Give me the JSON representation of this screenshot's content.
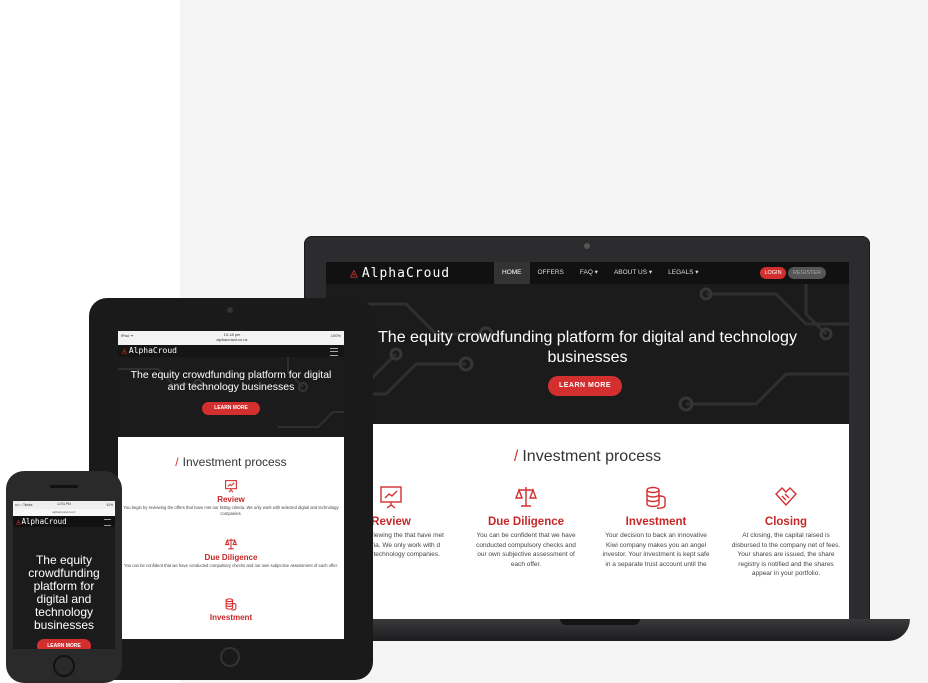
{
  "brand": {
    "name": "AlphaCroud",
    "accent": "#d32f2f"
  },
  "laptop": {
    "nav": [
      {
        "label": "HOME",
        "active": true
      },
      {
        "label": "OFFERS"
      },
      {
        "label": "FAQ ▾"
      },
      {
        "label": "ABOUT US ▾"
      },
      {
        "label": "LEGALS ▾"
      }
    ],
    "login_label": "LOGIN",
    "register_label": "REGISTER",
    "hero_title": "The equity crowdfunding platform for digital and technology businesses",
    "hero_button": "LEARN MORE",
    "section_title": "Investment process",
    "steps": [
      {
        "title": "Review",
        "icon": "presentation-icon",
        "desc": "begin by reviewing the that have met our listing ria. We only work with d digital and technology companies."
      },
      {
        "title": "Due Diligence",
        "icon": "scales-icon",
        "desc": "You can be confident that we have conducted compulsory checks and our own subjective assessment of each offer."
      },
      {
        "title": "Investment",
        "icon": "coins-icon",
        "desc": "Your decision to back an innovative Kiwi company makes you an angel investor. Your investment is kept safe in a separate trust account until the"
      },
      {
        "title": "Closing",
        "icon": "handshake-icon",
        "desc": "At closing, the capital raised is disbursed to the company net of fees. Your shares are issued, the share registry is notified and the shares appear in your portfolio."
      }
    ]
  },
  "tablet": {
    "status_left": "iPad ᯤ",
    "status_center": "10:18 pm",
    "status_url": "alphacrowd.co.nz",
    "status_right": "100%",
    "hero_title": "The equity crowdfunding platform for digital and technology businesses",
    "hero_button": "LEARN MORE",
    "section_title": "Investment process",
    "steps": [
      {
        "title": "Review",
        "icon": "presentation-icon",
        "desc": "You begin by reviewing the offers that have met our listing criteria. We only work with selected digital and technology companies."
      },
      {
        "title": "Due Diligence",
        "icon": "scales-icon",
        "desc": "You can be confident that we have conducted compulsory checks and our own subjective assessment of each offer."
      },
      {
        "title": "Investment",
        "icon": "coins-icon",
        "desc": ""
      }
    ]
  },
  "phone": {
    "status_left": "•••○○ Telstra",
    "status_center": "12:51 PM",
    "status_right": "61%",
    "address": "alphacrowd.co.nz",
    "hero_title": "The equity crowdfunding platform for digital and technology businesses",
    "hero_button": "LEARN MORE"
  }
}
